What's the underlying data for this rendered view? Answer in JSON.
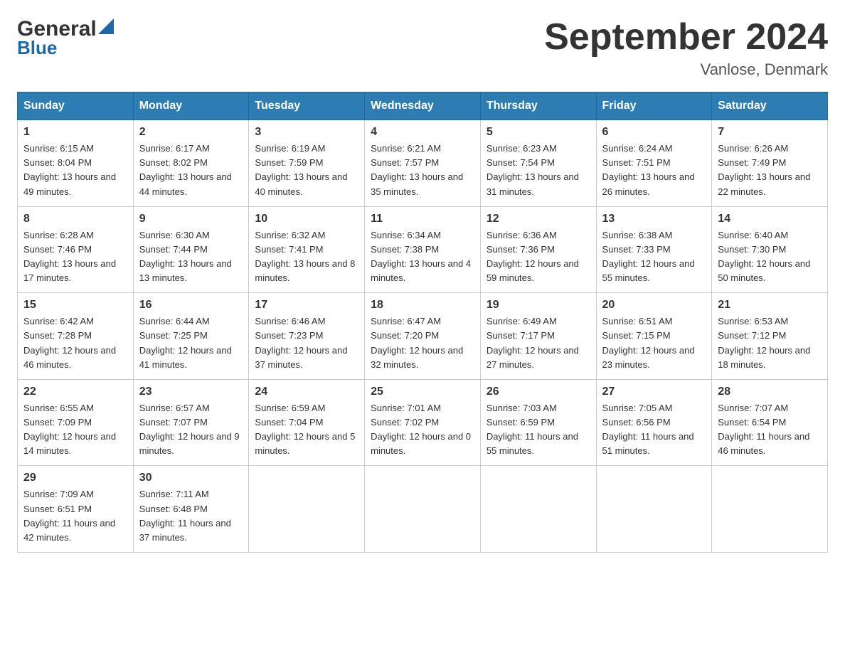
{
  "header": {
    "logo_general": "General",
    "logo_blue": "Blue",
    "title": "September 2024",
    "subtitle": "Vanlose, Denmark"
  },
  "days_of_week": [
    "Sunday",
    "Monday",
    "Tuesday",
    "Wednesday",
    "Thursday",
    "Friday",
    "Saturday"
  ],
  "weeks": [
    [
      {
        "day": "1",
        "sunrise": "6:15 AM",
        "sunset": "8:04 PM",
        "daylight": "13 hours and 49 minutes."
      },
      {
        "day": "2",
        "sunrise": "6:17 AM",
        "sunset": "8:02 PM",
        "daylight": "13 hours and 44 minutes."
      },
      {
        "day": "3",
        "sunrise": "6:19 AM",
        "sunset": "7:59 PM",
        "daylight": "13 hours and 40 minutes."
      },
      {
        "day": "4",
        "sunrise": "6:21 AM",
        "sunset": "7:57 PM",
        "daylight": "13 hours and 35 minutes."
      },
      {
        "day": "5",
        "sunrise": "6:23 AM",
        "sunset": "7:54 PM",
        "daylight": "13 hours and 31 minutes."
      },
      {
        "day": "6",
        "sunrise": "6:24 AM",
        "sunset": "7:51 PM",
        "daylight": "13 hours and 26 minutes."
      },
      {
        "day": "7",
        "sunrise": "6:26 AM",
        "sunset": "7:49 PM",
        "daylight": "13 hours and 22 minutes."
      }
    ],
    [
      {
        "day": "8",
        "sunrise": "6:28 AM",
        "sunset": "7:46 PM",
        "daylight": "13 hours and 17 minutes."
      },
      {
        "day": "9",
        "sunrise": "6:30 AM",
        "sunset": "7:44 PM",
        "daylight": "13 hours and 13 minutes."
      },
      {
        "day": "10",
        "sunrise": "6:32 AM",
        "sunset": "7:41 PM",
        "daylight": "13 hours and 8 minutes."
      },
      {
        "day": "11",
        "sunrise": "6:34 AM",
        "sunset": "7:38 PM",
        "daylight": "13 hours and 4 minutes."
      },
      {
        "day": "12",
        "sunrise": "6:36 AM",
        "sunset": "7:36 PM",
        "daylight": "12 hours and 59 minutes."
      },
      {
        "day": "13",
        "sunrise": "6:38 AM",
        "sunset": "7:33 PM",
        "daylight": "12 hours and 55 minutes."
      },
      {
        "day": "14",
        "sunrise": "6:40 AM",
        "sunset": "7:30 PM",
        "daylight": "12 hours and 50 minutes."
      }
    ],
    [
      {
        "day": "15",
        "sunrise": "6:42 AM",
        "sunset": "7:28 PM",
        "daylight": "12 hours and 46 minutes."
      },
      {
        "day": "16",
        "sunrise": "6:44 AM",
        "sunset": "7:25 PM",
        "daylight": "12 hours and 41 minutes."
      },
      {
        "day": "17",
        "sunrise": "6:46 AM",
        "sunset": "7:23 PM",
        "daylight": "12 hours and 37 minutes."
      },
      {
        "day": "18",
        "sunrise": "6:47 AM",
        "sunset": "7:20 PM",
        "daylight": "12 hours and 32 minutes."
      },
      {
        "day": "19",
        "sunrise": "6:49 AM",
        "sunset": "7:17 PM",
        "daylight": "12 hours and 27 minutes."
      },
      {
        "day": "20",
        "sunrise": "6:51 AM",
        "sunset": "7:15 PM",
        "daylight": "12 hours and 23 minutes."
      },
      {
        "day": "21",
        "sunrise": "6:53 AM",
        "sunset": "7:12 PM",
        "daylight": "12 hours and 18 minutes."
      }
    ],
    [
      {
        "day": "22",
        "sunrise": "6:55 AM",
        "sunset": "7:09 PM",
        "daylight": "12 hours and 14 minutes."
      },
      {
        "day": "23",
        "sunrise": "6:57 AM",
        "sunset": "7:07 PM",
        "daylight": "12 hours and 9 minutes."
      },
      {
        "day": "24",
        "sunrise": "6:59 AM",
        "sunset": "7:04 PM",
        "daylight": "12 hours and 5 minutes."
      },
      {
        "day": "25",
        "sunrise": "7:01 AM",
        "sunset": "7:02 PM",
        "daylight": "12 hours and 0 minutes."
      },
      {
        "day": "26",
        "sunrise": "7:03 AM",
        "sunset": "6:59 PM",
        "daylight": "11 hours and 55 minutes."
      },
      {
        "day": "27",
        "sunrise": "7:05 AM",
        "sunset": "6:56 PM",
        "daylight": "11 hours and 51 minutes."
      },
      {
        "day": "28",
        "sunrise": "7:07 AM",
        "sunset": "6:54 PM",
        "daylight": "11 hours and 46 minutes."
      }
    ],
    [
      {
        "day": "29",
        "sunrise": "7:09 AM",
        "sunset": "6:51 PM",
        "daylight": "11 hours and 42 minutes."
      },
      {
        "day": "30",
        "sunrise": "7:11 AM",
        "sunset": "6:48 PM",
        "daylight": "11 hours and 37 minutes."
      },
      null,
      null,
      null,
      null,
      null
    ]
  ],
  "labels": {
    "sunrise": "Sunrise:",
    "sunset": "Sunset:",
    "daylight": "Daylight:"
  }
}
